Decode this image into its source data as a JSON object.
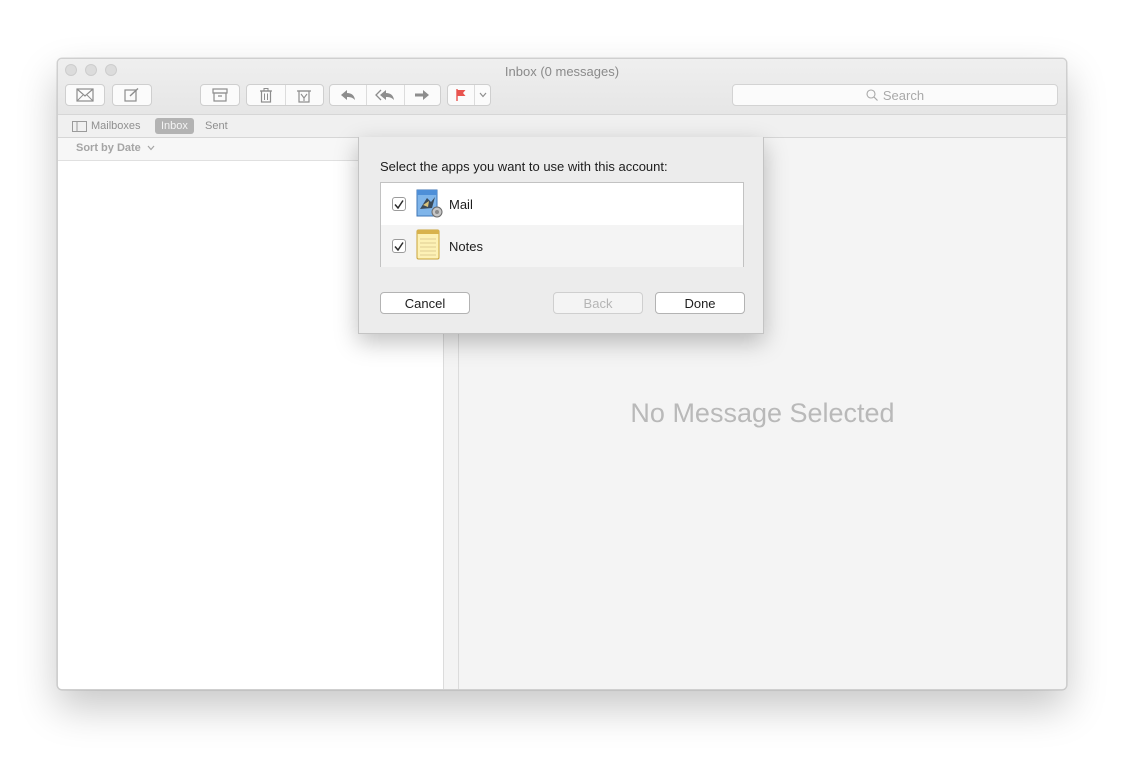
{
  "window": {
    "title": "Inbox (0 messages)"
  },
  "toolbar": {
    "buttons": [
      {
        "icon": "envelope-icon"
      },
      {
        "icon": "compose-icon"
      },
      {
        "icon": "archive-icon"
      },
      {
        "icon": "trash-icon"
      },
      {
        "icon": "junk-icon"
      },
      {
        "icon": "reply-icon"
      },
      {
        "icon": "reply-all-icon"
      },
      {
        "icon": "forward-icon"
      },
      {
        "icon": "flag-icon",
        "color": "#e8534e"
      },
      {
        "icon": "chevron-down-icon"
      }
    ],
    "search_placeholder": "Search"
  },
  "favorites": {
    "mailboxes_label": "Mailboxes",
    "inbox_label": "Inbox",
    "sent_label": "Sent"
  },
  "message_list": {
    "sort_label": "Sort by Date"
  },
  "message_view": {
    "empty_text": "No Message Selected"
  },
  "dialog": {
    "prompt": "Select the apps you want to use with this account:",
    "apps": [
      {
        "name": "Mail",
        "checked": true,
        "icon": "mail-app-icon"
      },
      {
        "name": "Notes",
        "checked": true,
        "icon": "notes-app-icon"
      }
    ],
    "cancel_label": "Cancel",
    "back_label": "Back",
    "done_label": "Done"
  }
}
